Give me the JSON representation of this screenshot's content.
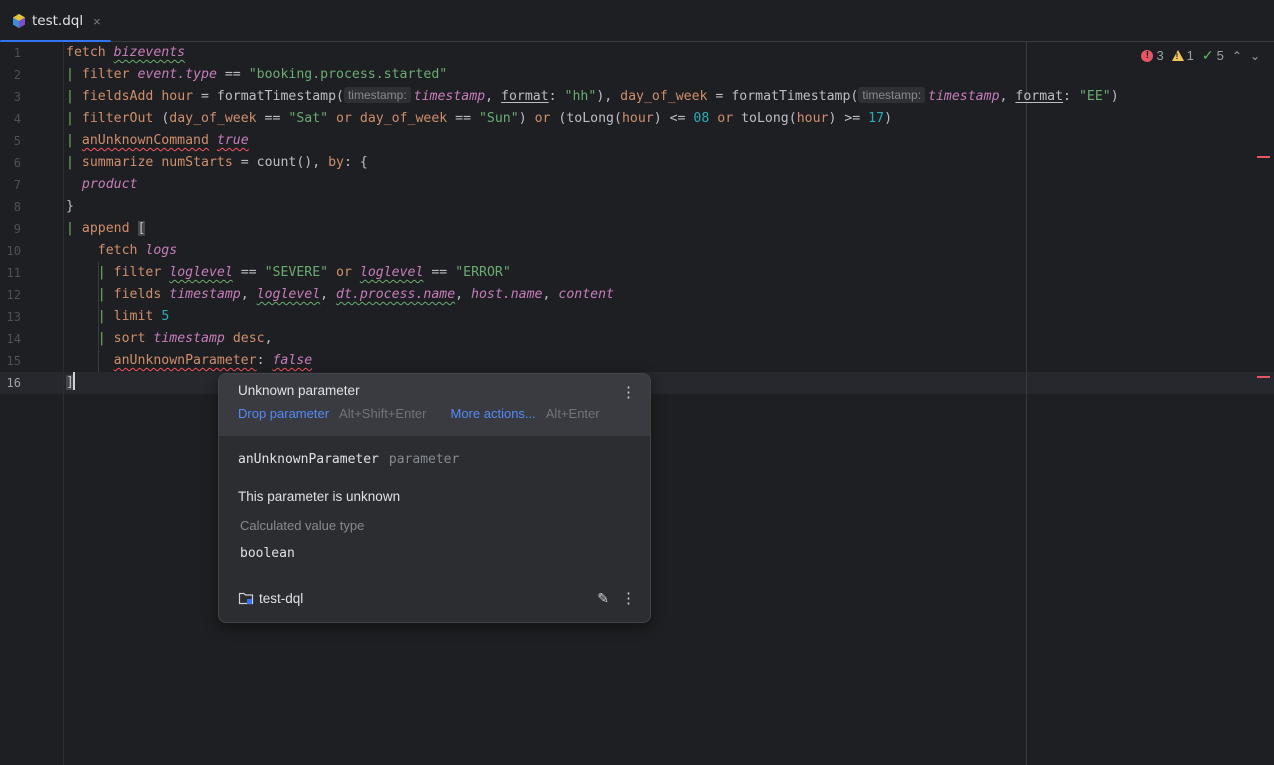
{
  "tab": {
    "title": "test.dql",
    "close": "×"
  },
  "status": {
    "errors": "3",
    "warnings": "1",
    "ok": "5"
  },
  "line_numbers": [
    "1",
    "2",
    "3",
    "4",
    "5",
    "6",
    "7",
    "8",
    "9",
    "10",
    "11",
    "12",
    "13",
    "14",
    "15",
    "16"
  ],
  "code": {
    "l1": {
      "kw": "fetch",
      "src": "bizevents"
    },
    "l2": {
      "cmd": "filter",
      "field": "event.type",
      "op": "==",
      "val": "\"booking.process.started\""
    },
    "l3": {
      "cmd": "fieldsAdd",
      "f1": "hour",
      "fn1": "formatTimestamp(",
      "hint1": "timestamp:",
      "a1": "timestamp",
      "p1": "format",
      "v1": "\"hh\"",
      "f2": "day_of_week",
      "fn2": "formatTimestamp(",
      "hint2": "timestamp:",
      "a2": "timestamp",
      "p2": "format",
      "v2": "\"EE\""
    },
    "l4": {
      "cmd": "filterOut",
      "f1": "day_of_week",
      "v1": "\"Sat\"",
      "or": "or",
      "f2": "day_of_week",
      "v2": "\"Sun\"",
      "fn": "toLong",
      "f3": "hour",
      "n1": "08",
      "f4": "hour",
      "n2": "17"
    },
    "l5": {
      "cmd": "anUnknownCommand",
      "val": "true"
    },
    "l6": {
      "cmd": "summarize",
      "name": "numStarts",
      "fn": "count()",
      "by": "by"
    },
    "l7": {
      "field": "product"
    },
    "l8": {
      "text": "}"
    },
    "l9": {
      "cmd": "append",
      "bracket": "["
    },
    "l10": {
      "kw": "fetch",
      "src": "logs"
    },
    "l11": {
      "cmd": "filter",
      "f1": "loglevel",
      "v1": "\"SEVERE\"",
      "or": "or",
      "f2": "loglevel",
      "v2": "\"ERROR\""
    },
    "l12": {
      "cmd": "fields",
      "f1": "timestamp",
      "f2": "loglevel",
      "f3": "dt.process.name",
      "f4": "host.name",
      "f5": "content"
    },
    "l13": {
      "cmd": "limit",
      "n": "5"
    },
    "l14": {
      "cmd": "sort",
      "f": "timestamp",
      "dir": "desc"
    },
    "l15": {
      "param": "anUnknownParameter",
      "val": "false"
    },
    "l16": {
      "text": "]"
    }
  },
  "popup": {
    "title": "Unknown parameter",
    "action1": "Drop parameter",
    "shortcut1": "Alt+Shift+Enter",
    "action2": "More actions...",
    "shortcut2": "Alt+Enter",
    "symbol": "anUnknownParameter",
    "kind": "parameter",
    "description": "This parameter is unknown",
    "calc_label": "Calculated value type",
    "calc_value": "boolean",
    "module": "test-dql"
  },
  "icons": {
    "file": "dql-file-icon",
    "error": "error-icon",
    "warning": "warning-icon",
    "check": "check-icon",
    "folder": "module-folder-icon",
    "edit": "pencil-icon",
    "more": "more-vertical-icon"
  },
  "colors": {
    "accent": "#3574f0",
    "keyword": "#cf8e6d",
    "identifier": "#c77dbb",
    "string": "#6aab73",
    "number": "#2aacb8",
    "error": "#e55765",
    "link": "#548af7"
  }
}
